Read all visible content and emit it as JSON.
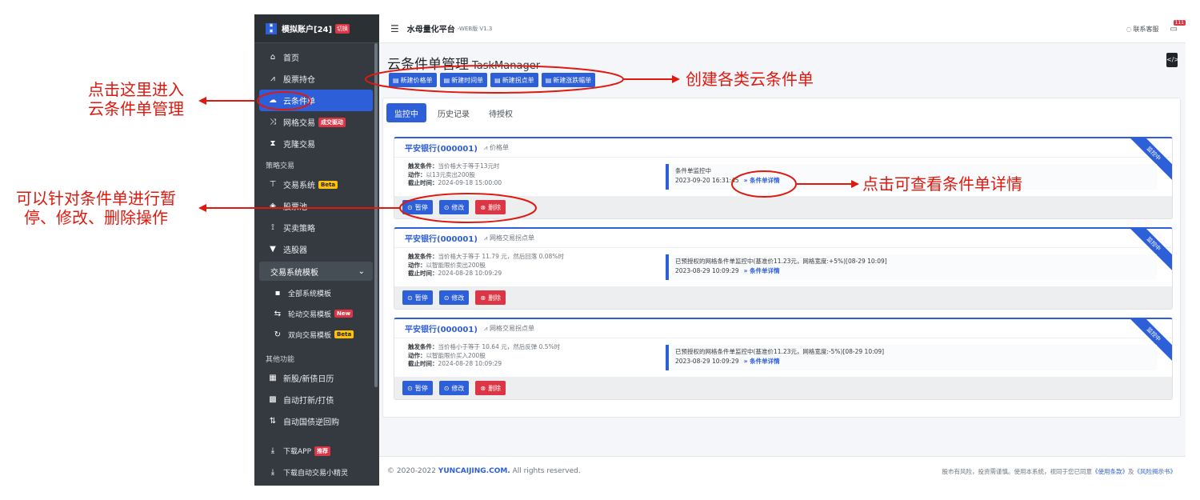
{
  "sidebar": {
    "account": "模拟账户[24]",
    "switch_label": "切换",
    "items": [
      {
        "label": "首页",
        "icon": "home-icon"
      },
      {
        "label": "股票持仓",
        "icon": "chart-icon"
      },
      {
        "label": "云条件单",
        "icon": "cloud-icon"
      },
      {
        "label": "网格交易",
        "icon": "shuffle-icon",
        "badge": "成交驱动"
      },
      {
        "label": "克隆交易",
        "icon": "hourglass-icon"
      }
    ],
    "section_strategy": "策略交易",
    "strategy_items": [
      {
        "label": "交易系统",
        "icon": "sitemap-icon",
        "badge": "Beta"
      },
      {
        "label": "股票池",
        "icon": "cube-icon"
      },
      {
        "label": "买卖策略",
        "icon": "flow-icon"
      },
      {
        "label": "选股器",
        "icon": "filter-icon"
      }
    ],
    "group_label": "交易系统模板",
    "group_items": [
      {
        "label": "全部系统模板",
        "icon": "book-icon"
      },
      {
        "label": "轮动交易模板",
        "icon": "swap-icon",
        "badge": "New"
      },
      {
        "label": "双向交易模板",
        "icon": "sync-icon",
        "badge": "Beta"
      }
    ],
    "section_other": "其他功能",
    "other_items": [
      {
        "label": "新股/新债日历",
        "icon": "calendar-icon"
      },
      {
        "label": "自动打新/打债",
        "icon": "grid-calendar-icon"
      },
      {
        "label": "自动国债逆回购",
        "icon": "sort-icon"
      }
    ],
    "download_items": [
      {
        "label": "下载APP",
        "badge": "推荐"
      },
      {
        "label": "下载自动交易小精灵"
      }
    ]
  },
  "topbar": {
    "brand": "水母量化平台",
    "version": "-WEB版 V1.3",
    "support": "联系客服",
    "notif_count": "111"
  },
  "page": {
    "title": "云条件单管理",
    "title_en": "TaskManager",
    "buttons": [
      "新建价格单",
      "新建时间单",
      "新建拐点单",
      "新建涨跌幅单"
    ]
  },
  "tabs": [
    "监控中",
    "历史记录",
    "待授权"
  ],
  "labels": {
    "trigger": "触发条件：",
    "action": "动作：",
    "deadline": "截止时间：",
    "detail": "» 条件单详情",
    "pause": "暂停",
    "edit": "修改",
    "delete": "删除",
    "ribbon": "监控中"
  },
  "cards": [
    {
      "stock": "平安银行(000001)",
      "type": "价格单",
      "trigger": "当价格大于等于13元时",
      "action": "以13元卖出200股",
      "deadline": "2024-09-18 15:00:00",
      "status_line1": "条件单监控中",
      "status_time": "2023-09-20 16:31:45"
    },
    {
      "stock": "平安银行(000001)",
      "type": "网格交易拐点单",
      "trigger": "当价格大于等于 11.79 元，然后回落 0.08%时",
      "action": "以智能限价卖出200股",
      "deadline": "2024-08-28 10:09:29",
      "status_line1": "已预授权的网格条件单监控中(基准价11.23元，网格宽度:+5%)[08-29 10:09]",
      "status_time": "2023-08-29 10:09:29"
    },
    {
      "stock": "平安银行(000001)",
      "type": "网格交易拐点单",
      "trigger": "当价格小于等于 10.64 元，然后反弹 0.5%时",
      "action": "以智能限价买入200股",
      "deadline": "2024-08-28 10:09:29",
      "status_line1": "已预授权的网格条件单监控中(基准价11.23元，网格宽度:-5%)[08-29 10:09]",
      "status_time": "2023-08-29 10:09:29"
    }
  ],
  "footer": {
    "copyright_prefix": "© 2020-2022",
    "copyright_site": "YUNCAIJING.COM.",
    "copyright_suffix": "All rights reserved.",
    "disclaimer": "股市有风险，投资需谨慎。使用本系统，视同于您已同意",
    "terms": "《使用条款》",
    "and": "及",
    "risk": "《风险揭示书》"
  },
  "annotations": {
    "enter": "点击这里进入\n云条件单管理",
    "create": "创建各类云条件单",
    "view_detail": "点击可查看条件单详情",
    "operate": "可以针对条件单进行暂\n停、修改、删除操作",
    "color": "#e0190f"
  }
}
